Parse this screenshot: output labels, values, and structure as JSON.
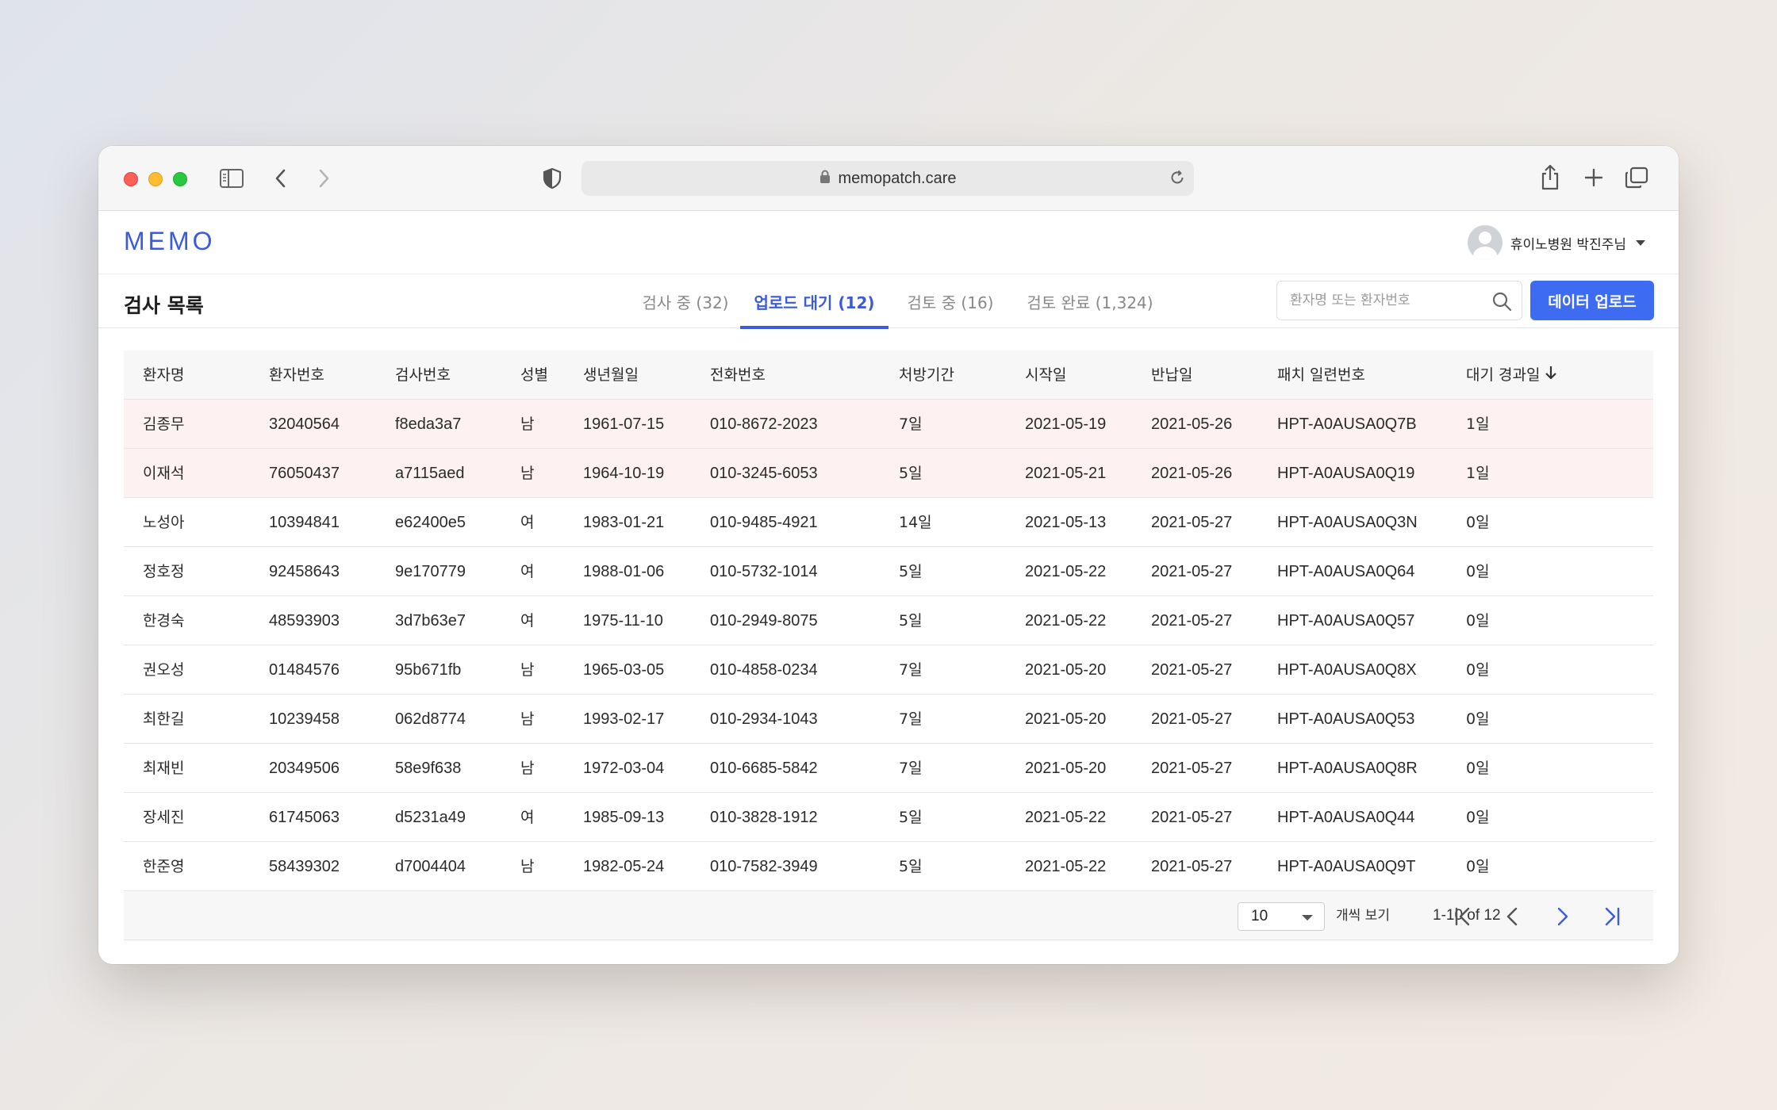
{
  "browser": {
    "url": "memopatch.care"
  },
  "app": {
    "logo": "MEMO",
    "user_name": "휴이노병원 박진주님"
  },
  "page": {
    "title": "검사 목록",
    "tabs": [
      {
        "label": "검사 중 (32)",
        "active": false
      },
      {
        "label": "업로드 대기 (12)",
        "active": true
      },
      {
        "label": "검토 중 (16)",
        "active": false
      },
      {
        "label": "검토 완료 (1,324)",
        "active": false
      }
    ],
    "search_placeholder": "환자명 또는 환자번호",
    "upload_button": "데이터 업로드"
  },
  "table": {
    "columns": [
      "환자명",
      "환자번호",
      "검사번호",
      "성별",
      "생년월일",
      "전화번호",
      "처방기간",
      "시작일",
      "반납일",
      "패치 일련번호",
      "대기 경과일"
    ],
    "rows": [
      {
        "name": "김종무",
        "pid": "32040564",
        "exam": "f8eda3a7",
        "sex": "남",
        "dob": "1961-07-15",
        "phone": "010-8672-2023",
        "period": "7일",
        "start": "2021-05-19",
        "return": "2021-05-26",
        "serial": "HPT-A0AUSA0Q7B",
        "wait": "1일",
        "highlight": true
      },
      {
        "name": "이재석",
        "pid": "76050437",
        "exam": "a7115aed",
        "sex": "남",
        "dob": "1964-10-19",
        "phone": "010-3245-6053",
        "period": "5일",
        "start": "2021-05-21",
        "return": "2021-05-26",
        "serial": "HPT-A0AUSA0Q19",
        "wait": "1일",
        "highlight": true
      },
      {
        "name": "노성아",
        "pid": "10394841",
        "exam": "e62400e5",
        "sex": "여",
        "dob": "1983-01-21",
        "phone": "010-9485-4921",
        "period": "14일",
        "start": "2021-05-13",
        "return": "2021-05-27",
        "serial": "HPT-A0AUSA0Q3N",
        "wait": "0일",
        "highlight": false
      },
      {
        "name": "정호정",
        "pid": "92458643",
        "exam": "9e170779",
        "sex": "여",
        "dob": "1988-01-06",
        "phone": "010-5732-1014",
        "period": "5일",
        "start": "2021-05-22",
        "return": "2021-05-27",
        "serial": "HPT-A0AUSA0Q64",
        "wait": "0일",
        "highlight": false
      },
      {
        "name": "한경숙",
        "pid": "48593903",
        "exam": "3d7b63e7",
        "sex": "여",
        "dob": "1975-11-10",
        "phone": "010-2949-8075",
        "period": "5일",
        "start": "2021-05-22",
        "return": "2021-05-27",
        "serial": "HPT-A0AUSA0Q57",
        "wait": "0일",
        "highlight": false
      },
      {
        "name": "권오성",
        "pid": "01484576",
        "exam": "95b671fb",
        "sex": "남",
        "dob": "1965-03-05",
        "phone": "010-4858-0234",
        "period": "7일",
        "start": "2021-05-20",
        "return": "2021-05-27",
        "serial": "HPT-A0AUSA0Q8X",
        "wait": "0일",
        "highlight": false
      },
      {
        "name": "최한길",
        "pid": "10239458",
        "exam": "062d8774",
        "sex": "남",
        "dob": "1993-02-17",
        "phone": "010-2934-1043",
        "period": "7일",
        "start": "2021-05-20",
        "return": "2021-05-27",
        "serial": "HPT-A0AUSA0Q53",
        "wait": "0일",
        "highlight": false
      },
      {
        "name": "최재빈",
        "pid": "20349506",
        "exam": "58e9f638",
        "sex": "남",
        "dob": "1972-03-04",
        "phone": "010-6685-5842",
        "period": "7일",
        "start": "2021-05-20",
        "return": "2021-05-27",
        "serial": "HPT-A0AUSA0Q8R",
        "wait": "0일",
        "highlight": false
      },
      {
        "name": "장세진",
        "pid": "61745063",
        "exam": "d5231a49",
        "sex": "여",
        "dob": "1985-09-13",
        "phone": "010-3828-1912",
        "period": "5일",
        "start": "2021-05-22",
        "return": "2021-05-27",
        "serial": "HPT-A0AUSA0Q44",
        "wait": "0일",
        "highlight": false
      },
      {
        "name": "한준영",
        "pid": "58439302",
        "exam": "d7004404",
        "sex": "남",
        "dob": "1982-05-24",
        "phone": "010-7582-3949",
        "period": "5일",
        "start": "2021-05-22",
        "return": "2021-05-27",
        "serial": "HPT-A0AUSA0Q9T",
        "wait": "0일",
        "highlight": false
      }
    ]
  },
  "pagination": {
    "page_size": "10",
    "per_page_label": "개씩 보기",
    "range": "1-10 of 12"
  },
  "colors": {
    "accent": "#3b5bdb",
    "button": "#3d6cf2",
    "highlight_row": "#fdf1f1"
  }
}
